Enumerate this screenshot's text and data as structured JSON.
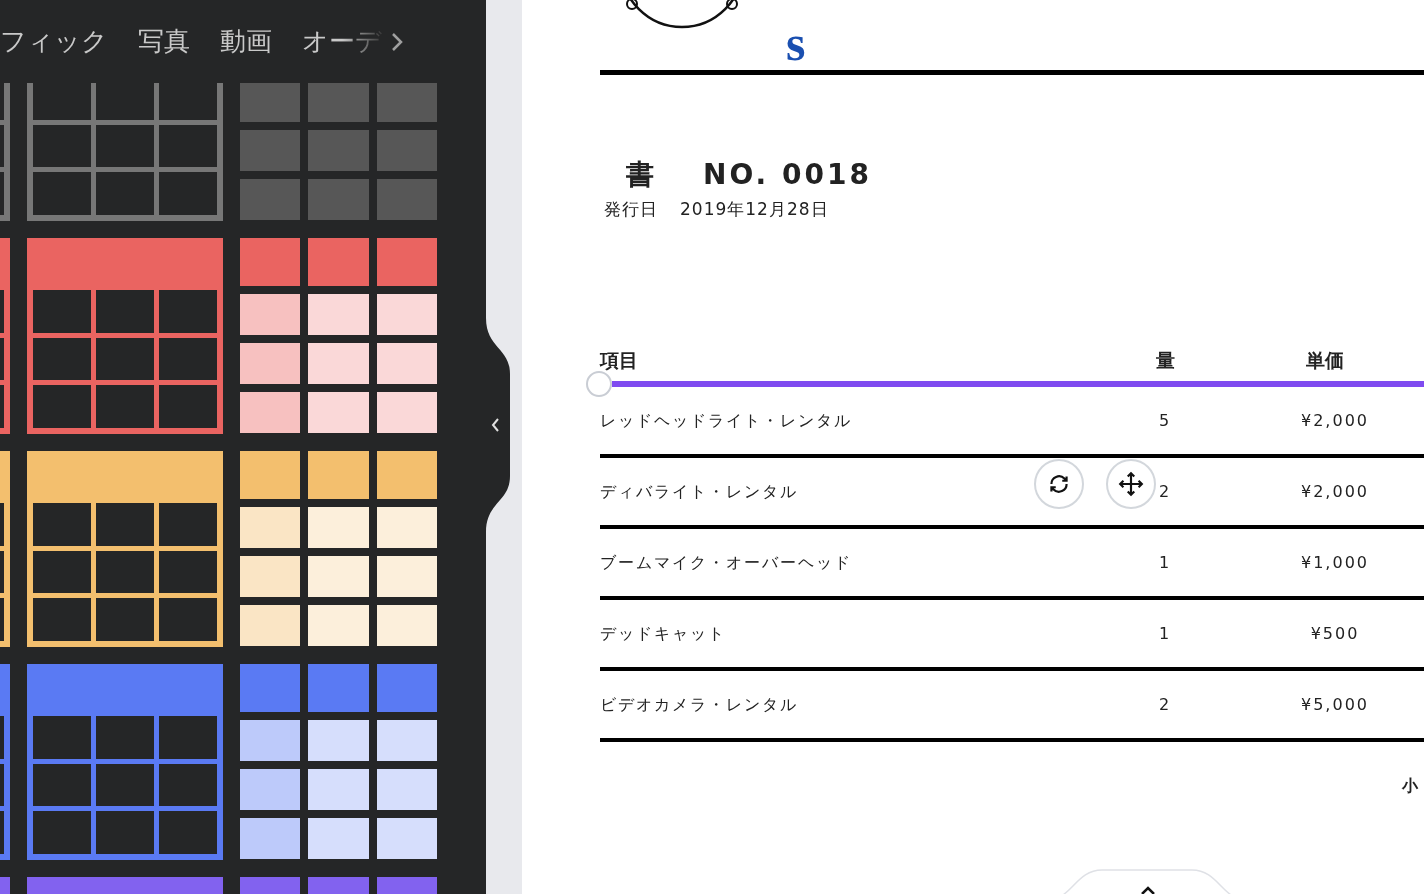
{
  "side_panel": {
    "tabs": [
      {
        "label": "フィック",
        "selected": false
      },
      {
        "label": "写真",
        "selected": false
      },
      {
        "label": "動画",
        "selected": false
      },
      {
        "label": "オーデ",
        "selected": false
      }
    ],
    "templates": [
      {
        "kind": "outline",
        "color": "#777777"
      },
      {
        "kind": "filled",
        "color": "#ea6461"
      },
      {
        "kind": "filled",
        "color": "#f3bf6e"
      },
      {
        "kind": "filled",
        "color": "#5a7af3"
      },
      {
        "kind": "filled",
        "color": "#8262ef"
      }
    ]
  },
  "document": {
    "company_name": "s",
    "title": "書",
    "number": "NO. 0018",
    "issue_label": "発行日",
    "issue_date": "2019年12月28日",
    "table": {
      "columns": [
        "項目",
        "量",
        "単価"
      ],
      "rows": [
        [
          "レッドヘッドライト・レンタル",
          "5",
          "¥2,000"
        ],
        [
          "ディバライト・レンタル",
          "2",
          "¥2,000"
        ],
        [
          "ブームマイク・オーバーヘッド",
          "1",
          "¥1,000"
        ],
        [
          "デッドキャット",
          "1",
          "¥500"
        ],
        [
          "ビデオカメラ・レンタル",
          "2",
          "¥5,000"
        ]
      ]
    },
    "subtotal_label": "小"
  }
}
